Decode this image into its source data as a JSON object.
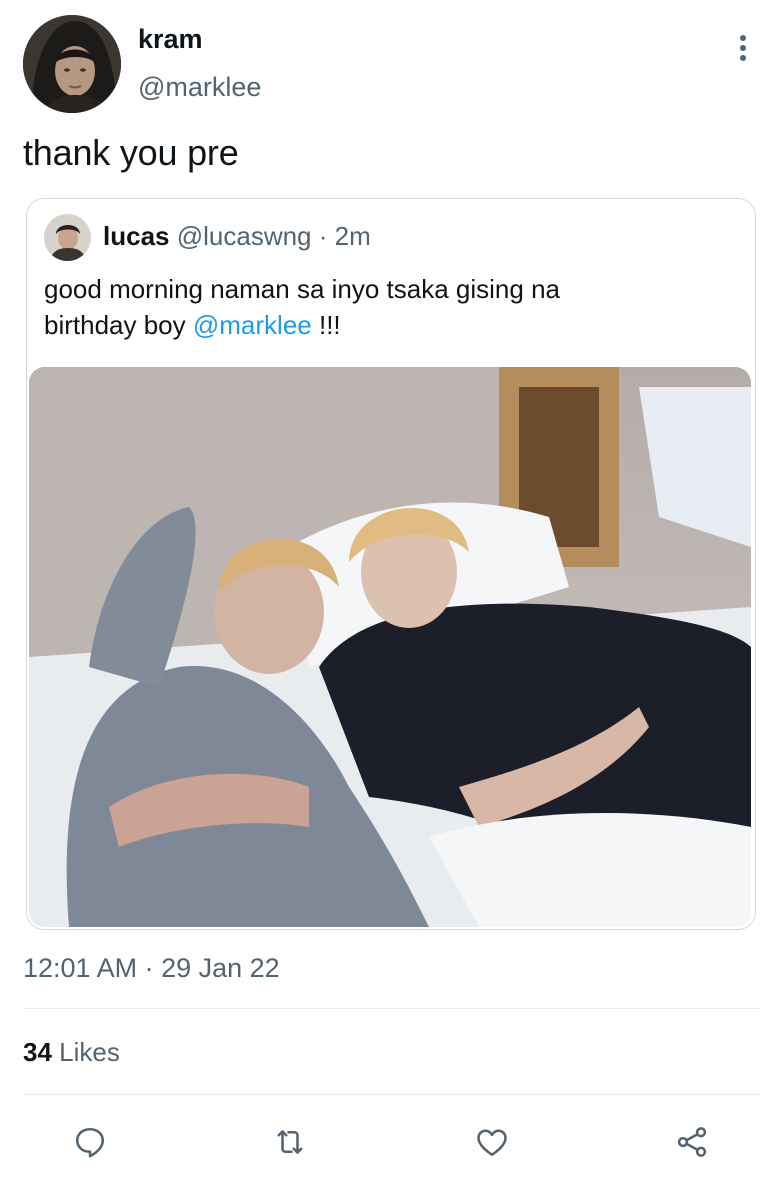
{
  "author": {
    "display_name": "kram",
    "handle": "@marklee",
    "avatar_icon": "profile-photo-hooded-person"
  },
  "tweet": {
    "text": "thank you pre"
  },
  "quoted_tweet": {
    "display_name": "lucas",
    "handle": "@lucaswng",
    "separator": "·",
    "time_ago": "2m",
    "text_line1": "good morning naman sa inyo tsaka gising na",
    "text_line2_prefix": "birthday boy ",
    "mention": "@marklee",
    "text_line2_suffix": " !!!",
    "avatar_icon": "profile-photo-person",
    "media_icon": "photo-two-people-sleeping-on-bed"
  },
  "meta": {
    "timestamp": "12:01 AM · 29 Jan 22",
    "likes_count": "34",
    "likes_label": " Likes"
  },
  "actions": {
    "reply_icon": "reply-icon",
    "retweet_icon": "retweet-icon",
    "like_icon": "heart-icon",
    "share_icon": "share-icon",
    "icon_color": "#536471"
  },
  "colors": {
    "text": "#0f1419",
    "secondary": "#536471",
    "link": "#1d9bf0",
    "border": "#cfd9de"
  }
}
